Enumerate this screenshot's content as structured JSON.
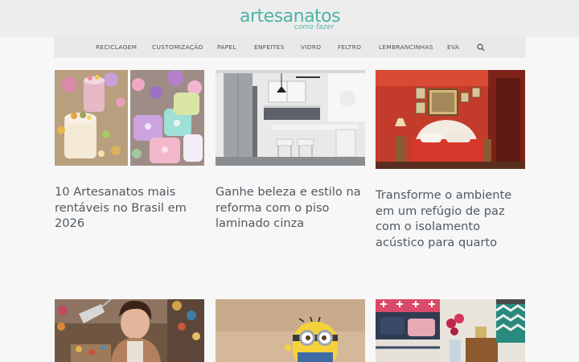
{
  "brand": {
    "logo_main": "artesanatos",
    "logo_sub": "como fazer",
    "accent": "#4bb3a5"
  },
  "nav": {
    "items": [
      "RECICLAGEM",
      "CUSTOMIZAÇÃO",
      "PAPEL",
      "ENFEITES",
      "VIDRO",
      "FELTRO",
      "LEMBRANCINHAS",
      "EVA"
    ],
    "search_icon": "search-icon"
  },
  "posts": [
    {
      "title": "10 Artesanatos mais rentáveis no Brasil em 2026",
      "image": "handmade-soaps-and-candles"
    },
    {
      "title": "Ganhe beleza e estilo na reforma com o piso laminado cinza",
      "image": "gray-kitchen-laminate-floor"
    },
    {
      "title": "Transforme o ambiente em um refúgio de paz com o isolamento acústico para quarto",
      "image": "red-bedroom"
    },
    {
      "title": "",
      "image": "artisan-woman-crafting"
    },
    {
      "title": "",
      "image": "minion-figure"
    },
    {
      "title": "",
      "image": "colorful-bedroom-decor"
    }
  ]
}
